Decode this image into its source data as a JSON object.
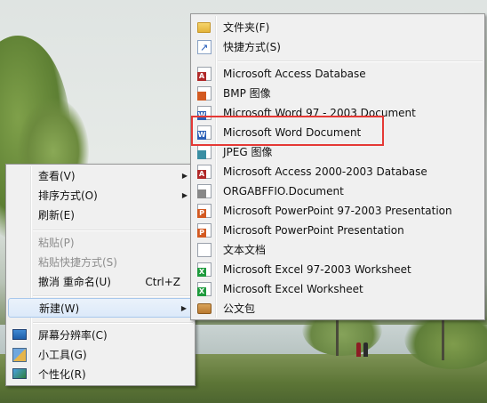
{
  "left_menu": {
    "items": [
      {
        "label": "查看(V)",
        "submenu": true,
        "disabled": false
      },
      {
        "label": "排序方式(O)",
        "submenu": true,
        "disabled": false
      },
      {
        "label": "刷新(E)",
        "submenu": false,
        "disabled": false
      },
      {
        "label": "粘贴(P)",
        "submenu": false,
        "disabled": true
      },
      {
        "label": "粘贴快捷方式(S)",
        "submenu": false,
        "disabled": true
      },
      {
        "label": "撤消 重命名(U)",
        "shortcut": "Ctrl+Z",
        "submenu": false,
        "disabled": false
      },
      {
        "label": "新建(W)",
        "submenu": true,
        "disabled": false,
        "highlighted": true
      },
      {
        "label": "屏幕分辨率(C)",
        "icon": "monitor-icon",
        "submenu": false,
        "disabled": false
      },
      {
        "label": "小工具(G)",
        "icon": "gadgets-icon",
        "submenu": false,
        "disabled": false
      },
      {
        "label": "个性化(R)",
        "icon": "personalize-icon",
        "submenu": false,
        "disabled": false
      }
    ]
  },
  "new_submenu": {
    "items": [
      {
        "label": "文件夹(F)",
        "icon": "folder-icon"
      },
      {
        "label": "快捷方式(S)",
        "icon": "shortcut-icon"
      },
      {
        "label": "Microsoft Access Database",
        "icon": "access-icon"
      },
      {
        "label": "BMP 图像",
        "icon": "bmp-icon"
      },
      {
        "label": "Microsoft Word 97 - 2003 Document",
        "icon": "word-icon"
      },
      {
        "label": "Microsoft Word Document",
        "icon": "word-icon",
        "outlined": true
      },
      {
        "label": "JPEG 图像",
        "icon": "jpeg-icon"
      },
      {
        "label": "Microsoft Access 2000-2003 Database",
        "icon": "access-icon"
      },
      {
        "label": "ORGABFFIO.Document",
        "icon": "document-icon"
      },
      {
        "label": "Microsoft PowerPoint 97-2003 Presentation",
        "icon": "powerpoint-icon"
      },
      {
        "label": "Microsoft PowerPoint Presentation",
        "icon": "powerpoint-icon"
      },
      {
        "label": "文本文档",
        "icon": "text-document-icon"
      },
      {
        "label": "Microsoft Excel 97-2003 Worksheet",
        "icon": "excel-icon"
      },
      {
        "label": "Microsoft Excel Worksheet",
        "icon": "excel-icon"
      },
      {
        "label": "公文包",
        "icon": "briefcase-icon"
      }
    ]
  },
  "colors": {
    "menu_bg": "#f0f0f0",
    "highlight_border": "#e53935",
    "hover_border": "#a8c8ec"
  }
}
